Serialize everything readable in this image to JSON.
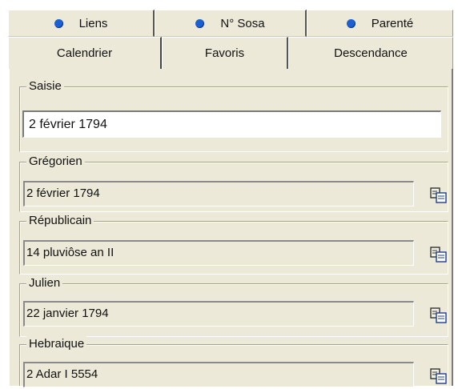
{
  "tabs_row1": [
    {
      "label": "Liens"
    },
    {
      "label": "N° Sosa"
    },
    {
      "label": "Parenté"
    }
  ],
  "tabs_row2": [
    {
      "label": "Calendrier",
      "active": true
    },
    {
      "label": "Favoris"
    },
    {
      "label": "Descendance"
    }
  ],
  "saisie": {
    "legend": "Saisie",
    "value": "2 février 1794"
  },
  "calendars": [
    {
      "legend": "Grégorien",
      "value": "2 février 1794",
      "copy_icon": "copy-to-clipboard-icon"
    },
    {
      "legend": "Républicain",
      "value": "14 pluviôse an II",
      "copy_icon": "copy-to-clipboard-icon"
    },
    {
      "legend": "Julien",
      "value": "22 janvier 1794",
      "copy_icon": "copy-to-clipboard-icon"
    },
    {
      "legend": "Hebraique",
      "value": "2 Adar I 5554",
      "copy_icon": "copy-to-clipboard-icon"
    }
  ],
  "colors": {
    "face": "#ece9d8",
    "tab_dot": "#1d5fd0"
  }
}
